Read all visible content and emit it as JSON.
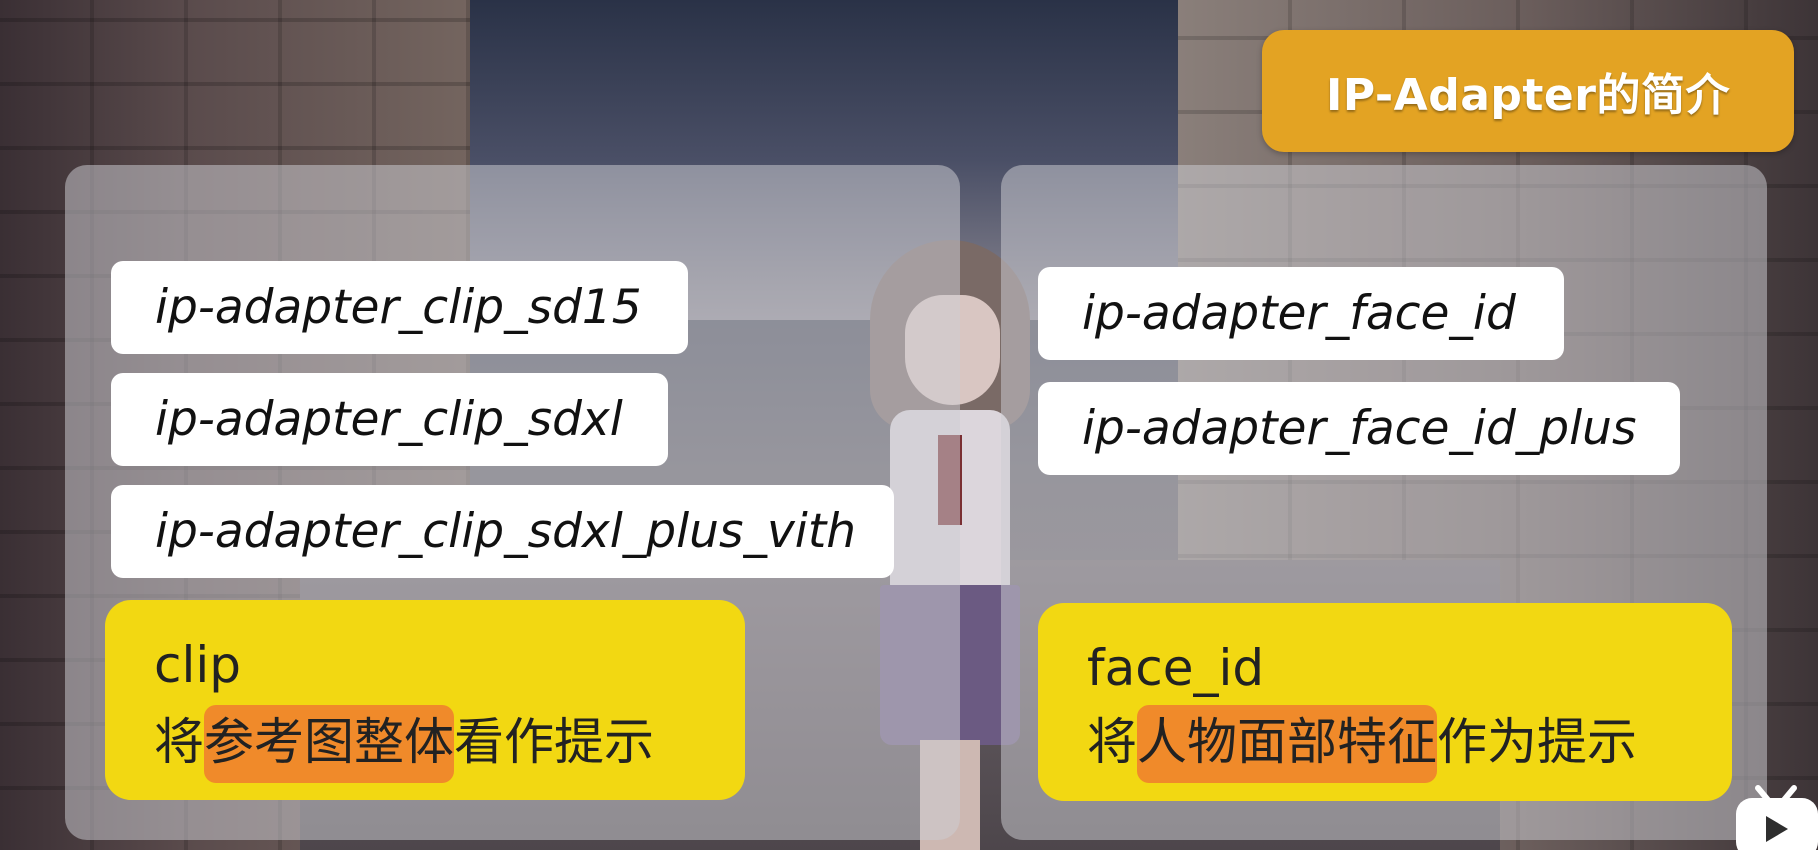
{
  "title": "IP-Adapter的简介",
  "left_panel": {
    "models": [
      "ip-adapter_clip_sd15",
      "ip-adapter_clip_sdxl",
      "ip-adapter_clip_sdxl_plus_vith"
    ],
    "summary": {
      "name": "clip",
      "desc_pre": "将",
      "desc_highlight": "参考图整体",
      "desc_post": "看作提示"
    }
  },
  "right_panel": {
    "models": [
      "ip-adapter_face_id",
      "ip-adapter_face_id_plus"
    ],
    "summary": {
      "name": "face_id",
      "desc_pre": "将",
      "desc_highlight": "人物面部特征",
      "desc_post": "作为提示"
    }
  },
  "colors": {
    "title_badge": "#e3a323",
    "summary_box": "#f2d812",
    "highlight": "#f08a2a",
    "chip": "#ffffff"
  },
  "icons": {
    "corner_logo": "tv-logo-icon"
  }
}
